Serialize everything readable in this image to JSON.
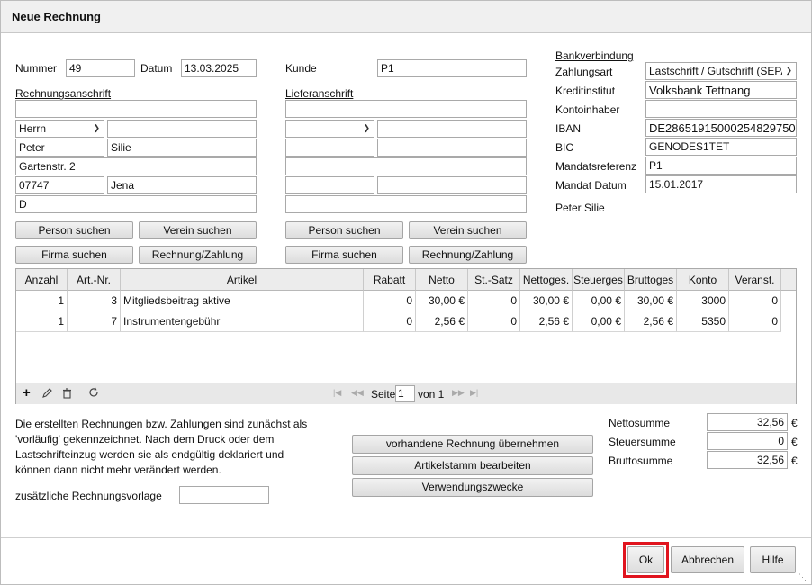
{
  "window": {
    "title": "Neue Rechnung"
  },
  "header": {
    "nummer_label": "Nummer",
    "nummer_value": "49",
    "datum_label": "Datum",
    "datum_value": "13.03.2025",
    "kunde_label": "Kunde",
    "kunde_value": "P1"
  },
  "billing": {
    "heading": "Rechnungsanschrift",
    "line1": "",
    "salutation": "Herrn",
    "title": "",
    "firstname": "Peter",
    "lastname": "Silie",
    "street": "Gartenstr. 2",
    "zip": "07747",
    "city": "Jena",
    "country": "D",
    "btn_person": "Person suchen",
    "btn_verein": "Verein suchen",
    "btn_firma": "Firma suchen",
    "btn_rechnung": "Rechnung/Zahlung"
  },
  "delivery": {
    "heading": "Lieferanschrift",
    "line1": "",
    "salutation": "",
    "title": "",
    "firstname": "",
    "lastname": "",
    "street": "",
    "zip": "",
    "city": "",
    "country": "",
    "btn_person": "Person suchen",
    "btn_verein": "Verein suchen",
    "btn_firma": "Firma suchen",
    "btn_rechnung": "Rechnung/Zahlung"
  },
  "bank": {
    "heading": "Bankverbindung",
    "zahlungsart_label": "Zahlungsart",
    "zahlungsart_value": "Lastschrift / Gutschrift (SEPA",
    "kreditinstitut_label": "Kreditinstitut",
    "kreditinstitut_value": "Volksbank Tettnang",
    "kontoinhaber_label": "Kontoinhaber",
    "kontoinhaber_value": "",
    "iban_label": "IBAN",
    "iban_value": "DE28651915000254829750",
    "bic_label": "BIC",
    "bic_value": "GENODES1TET",
    "mandatsref_label": "Mandatsreferenz",
    "mandatsref_value": "P1",
    "mandatdatum_label": "Mandat Datum",
    "mandatdatum_value": "15.01.2017",
    "name": "Peter Silie"
  },
  "table": {
    "columns": [
      "Anzahl",
      "Art.-Nr.",
      "Artikel",
      "Rabatt",
      "Netto",
      "St.-Satz",
      "Nettoges.",
      "Steuerges",
      "Bruttoges",
      "Konto",
      "Veranst."
    ],
    "rows": [
      [
        "1",
        "3",
        "Mitgliedsbeitrag aktive",
        "0",
        "30,00 €",
        "0",
        "30,00 €",
        "0,00 €",
        "30,00 €",
        "3000",
        "0"
      ],
      [
        "1",
        "7",
        "Instrumentengebühr",
        "0",
        "2,56 €",
        "0",
        "2,56 €",
        "0,00 €",
        "2,56 €",
        "5350",
        "0"
      ]
    ],
    "pager": {
      "seite_label": "Seite",
      "page": "1",
      "von_label": "von 1"
    }
  },
  "notes": {
    "text_lines": [
      "Die erstellten Rechnungen bzw. Zahlungen sind zunächst als",
      "'vorläufig' gekennzeichnet. Nach dem Druck oder dem",
      "Lastschrifteinzug werden sie als endgültig deklariert und",
      "können dann nicht mehr verändert werden."
    ],
    "vorlage_label": "zusätzliche Rechnungsvorlage",
    "vorlage_value": ""
  },
  "actions": {
    "uebernehmen": "vorhandene Rechnung übernehmen",
    "artikelstamm": "Artikelstamm bearbeiten",
    "verwendung": "Verwendungszwecke"
  },
  "totals": {
    "netto_label": "Nettosumme",
    "netto_value": "32,56",
    "netto_cur": "€",
    "steuer_label": "Steuersumme",
    "steuer_value": "0",
    "steuer_cur": "€",
    "brutto_label": "Bruttosumme",
    "brutto_value": "32,56",
    "brutto_cur": "€"
  },
  "footer": {
    "ok": "Ok",
    "abbrechen": "Abbrechen",
    "hilfe": "Hilfe"
  },
  "colors": {
    "highlight": "#e0141e"
  }
}
